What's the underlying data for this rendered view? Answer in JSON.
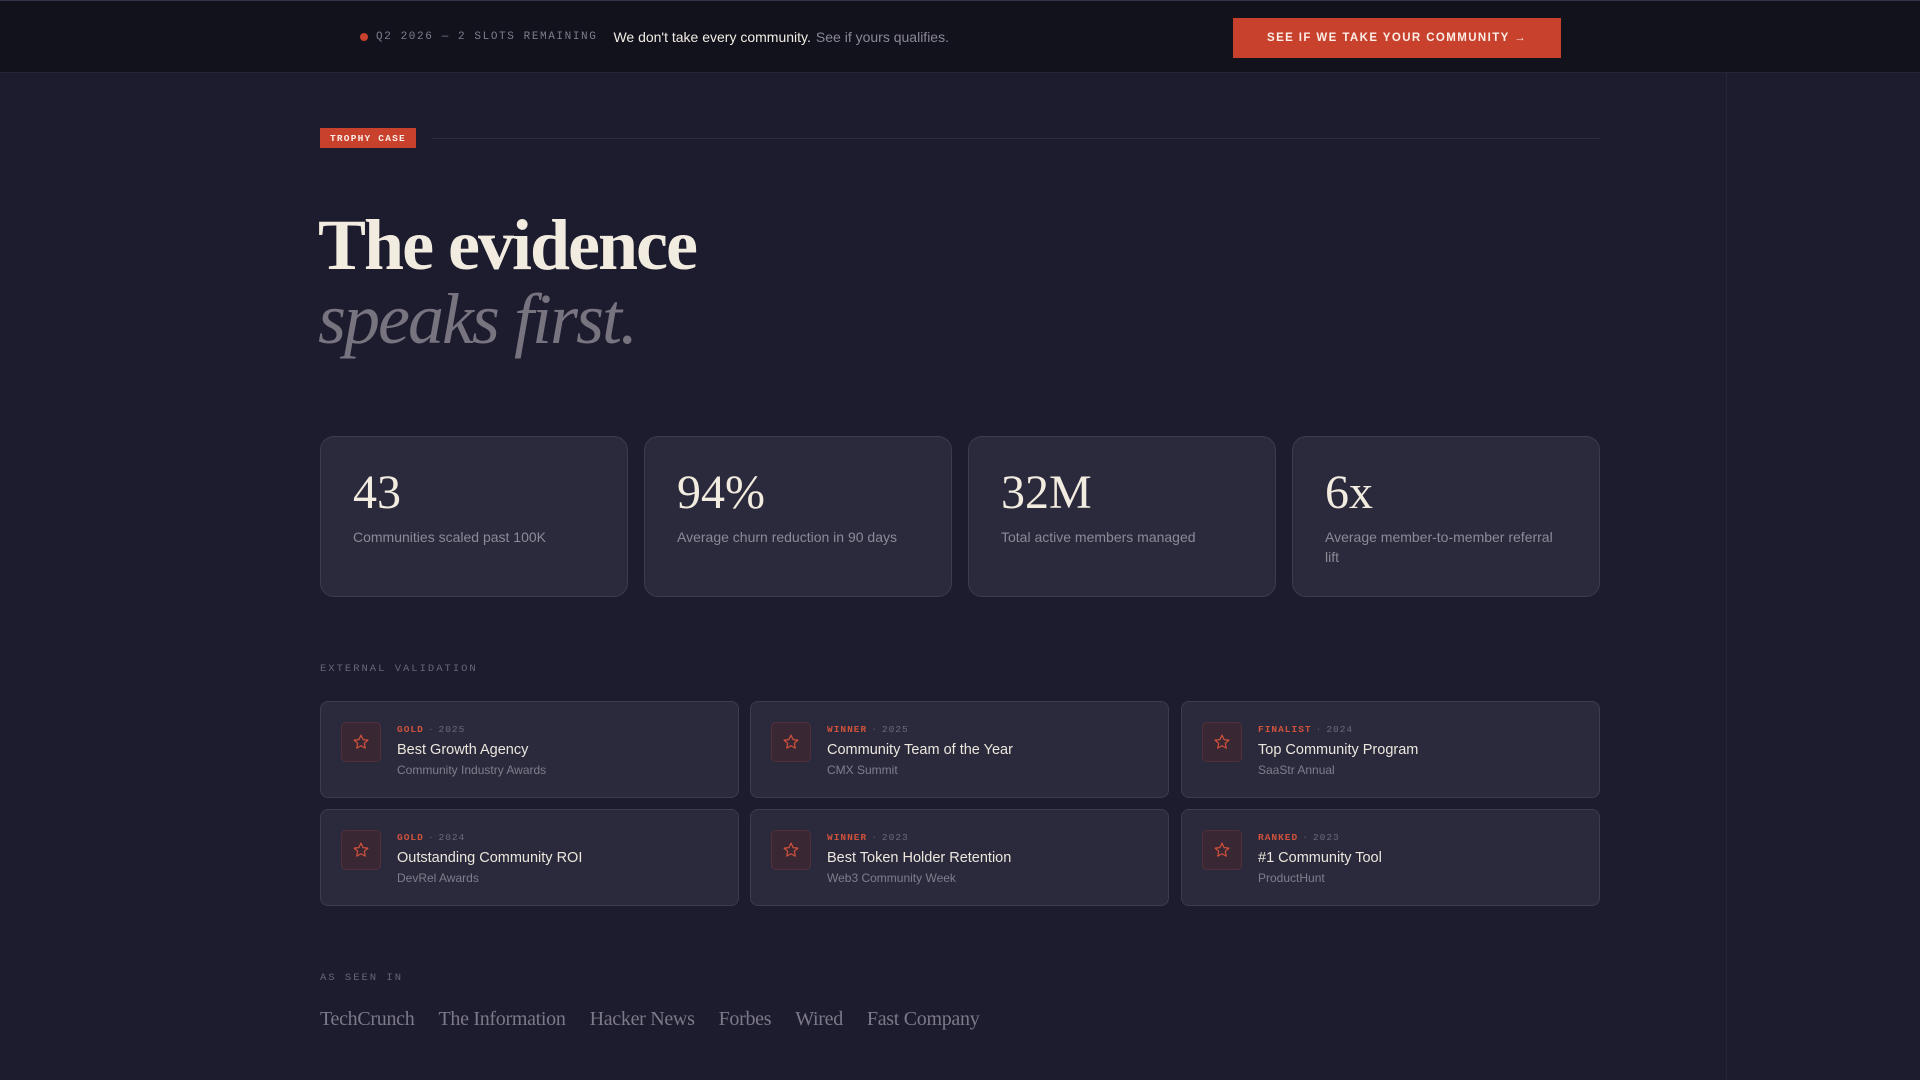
{
  "topbar": {
    "slots": "Q2 2026 — 2 SLOTS REMAINING",
    "tagline_main": "We don't take every community.",
    "tagline_sub": "See if yours qualifies.",
    "cta_label": "SEE IF WE TAKE YOUR COMMUNITY →"
  },
  "section": {
    "badge": "TROPHY CASE",
    "headline": "The evidence",
    "headline_italic": "speaks first."
  },
  "stats": [
    {
      "value": "43",
      "label": "Communities scaled past 100K"
    },
    {
      "value": "94%",
      "label": "Average churn reduction in 90 days"
    },
    {
      "value": "32M",
      "label": "Total active members managed"
    },
    {
      "value": "6x",
      "label": "Average member-to-member referral lift"
    }
  ],
  "validation": {
    "label": "EXTERNAL VALIDATION",
    "awards": [
      {
        "rank": "GOLD",
        "year": "2025",
        "title": "Best Growth Agency",
        "org": "Community Industry Awards"
      },
      {
        "rank": "WINNER",
        "year": "2025",
        "title": "Community Team of the Year",
        "org": "CMX Summit"
      },
      {
        "rank": "FINALIST",
        "year": "2024",
        "title": "Top Community Program",
        "org": "SaaStr Annual"
      },
      {
        "rank": "GOLD",
        "year": "2024",
        "title": "Outstanding Community ROI",
        "org": "DevRel Awards"
      },
      {
        "rank": "WINNER",
        "year": "2023",
        "title": "Best Token Holder Retention",
        "org": "Web3 Community Week"
      },
      {
        "rank": "RANKED",
        "year": "2023",
        "title": "#1 Community Tool",
        "org": "ProductHunt"
      }
    ],
    "separator": "·"
  },
  "press": {
    "label": "AS SEEN IN",
    "outlets": [
      "TechCrunch",
      "The Information",
      "Hacker News",
      "Forbes",
      "Wired",
      "Fast Company"
    ]
  },
  "icons": {
    "award": "star-icon",
    "status": "pulse-dot"
  },
  "colors": {
    "accent": "#c8412c",
    "background": "#1c1c2e",
    "card": "#2a2a3c"
  }
}
